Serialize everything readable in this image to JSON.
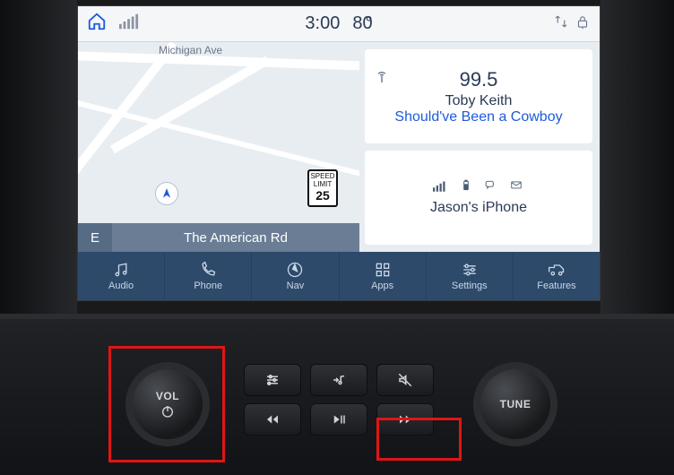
{
  "status": {
    "time": "3:00",
    "temp": "80",
    "temp_unit": "°"
  },
  "map": {
    "road_label": "Michigan Ave",
    "speed_label_1": "SPEED",
    "speed_label_2": "LIMIT",
    "speed_value": "25",
    "direction": "E",
    "street": "The American Rd"
  },
  "radio": {
    "freq": "99.5",
    "artist": "Toby Keith",
    "song": "Should've Been a Cowboy"
  },
  "phone": {
    "name": "Jason's iPhone"
  },
  "tabs": {
    "audio": "Audio",
    "phone": "Phone",
    "nav": "Nav",
    "apps": "Apps",
    "settings": "Settings",
    "features": "Features"
  },
  "knobs": {
    "vol": "VOL",
    "tune": "TUNE"
  }
}
